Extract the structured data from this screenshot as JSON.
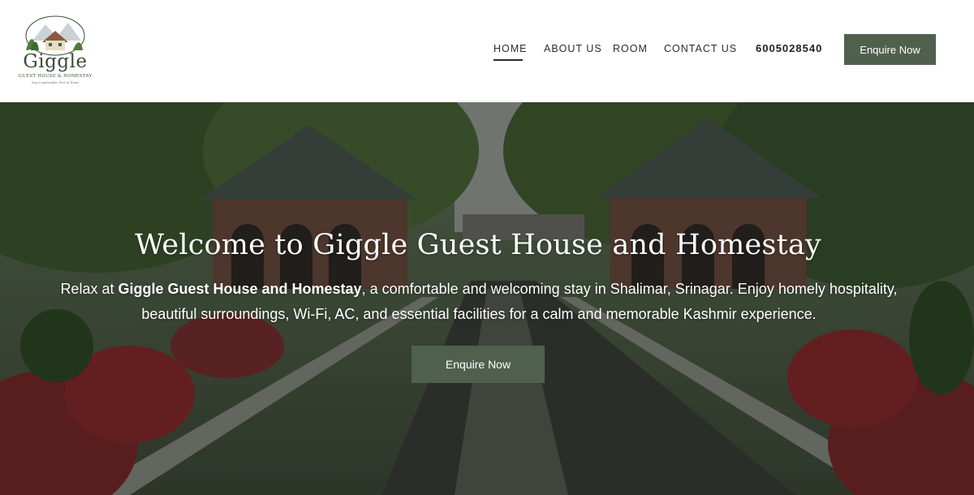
{
  "header": {
    "logo": {
      "word": "Giggle",
      "sub": "GUEST HOUSE & HOMESTAY",
      "tagline": "Stay Comfortable, Feel at Home"
    },
    "nav": [
      {
        "label": "HOME",
        "active": true
      },
      {
        "label": "ABOUT US",
        "active": false
      },
      {
        "label": "ROOM",
        "active": false
      },
      {
        "label": "CONTACT US",
        "active": false
      }
    ],
    "phone": "6005028540",
    "cta_label": "Enquire Now"
  },
  "hero": {
    "title": "Welcome to Giggle Guest House and Homestay",
    "text_before": "Relax at ",
    "text_bold": "Giggle Guest House and Homestay",
    "text_after": ", a comfortable and welcoming stay in Shalimar, Srinagar. Enjoy homely hospitality, beautiful surroundings, Wi-Fi, AC, and essential facilities for a calm and memorable Kashmir experience.",
    "cta_label": "Enquire Now"
  },
  "colors": {
    "accent": "#4f604f",
    "text_dark": "#2b2b2b"
  }
}
